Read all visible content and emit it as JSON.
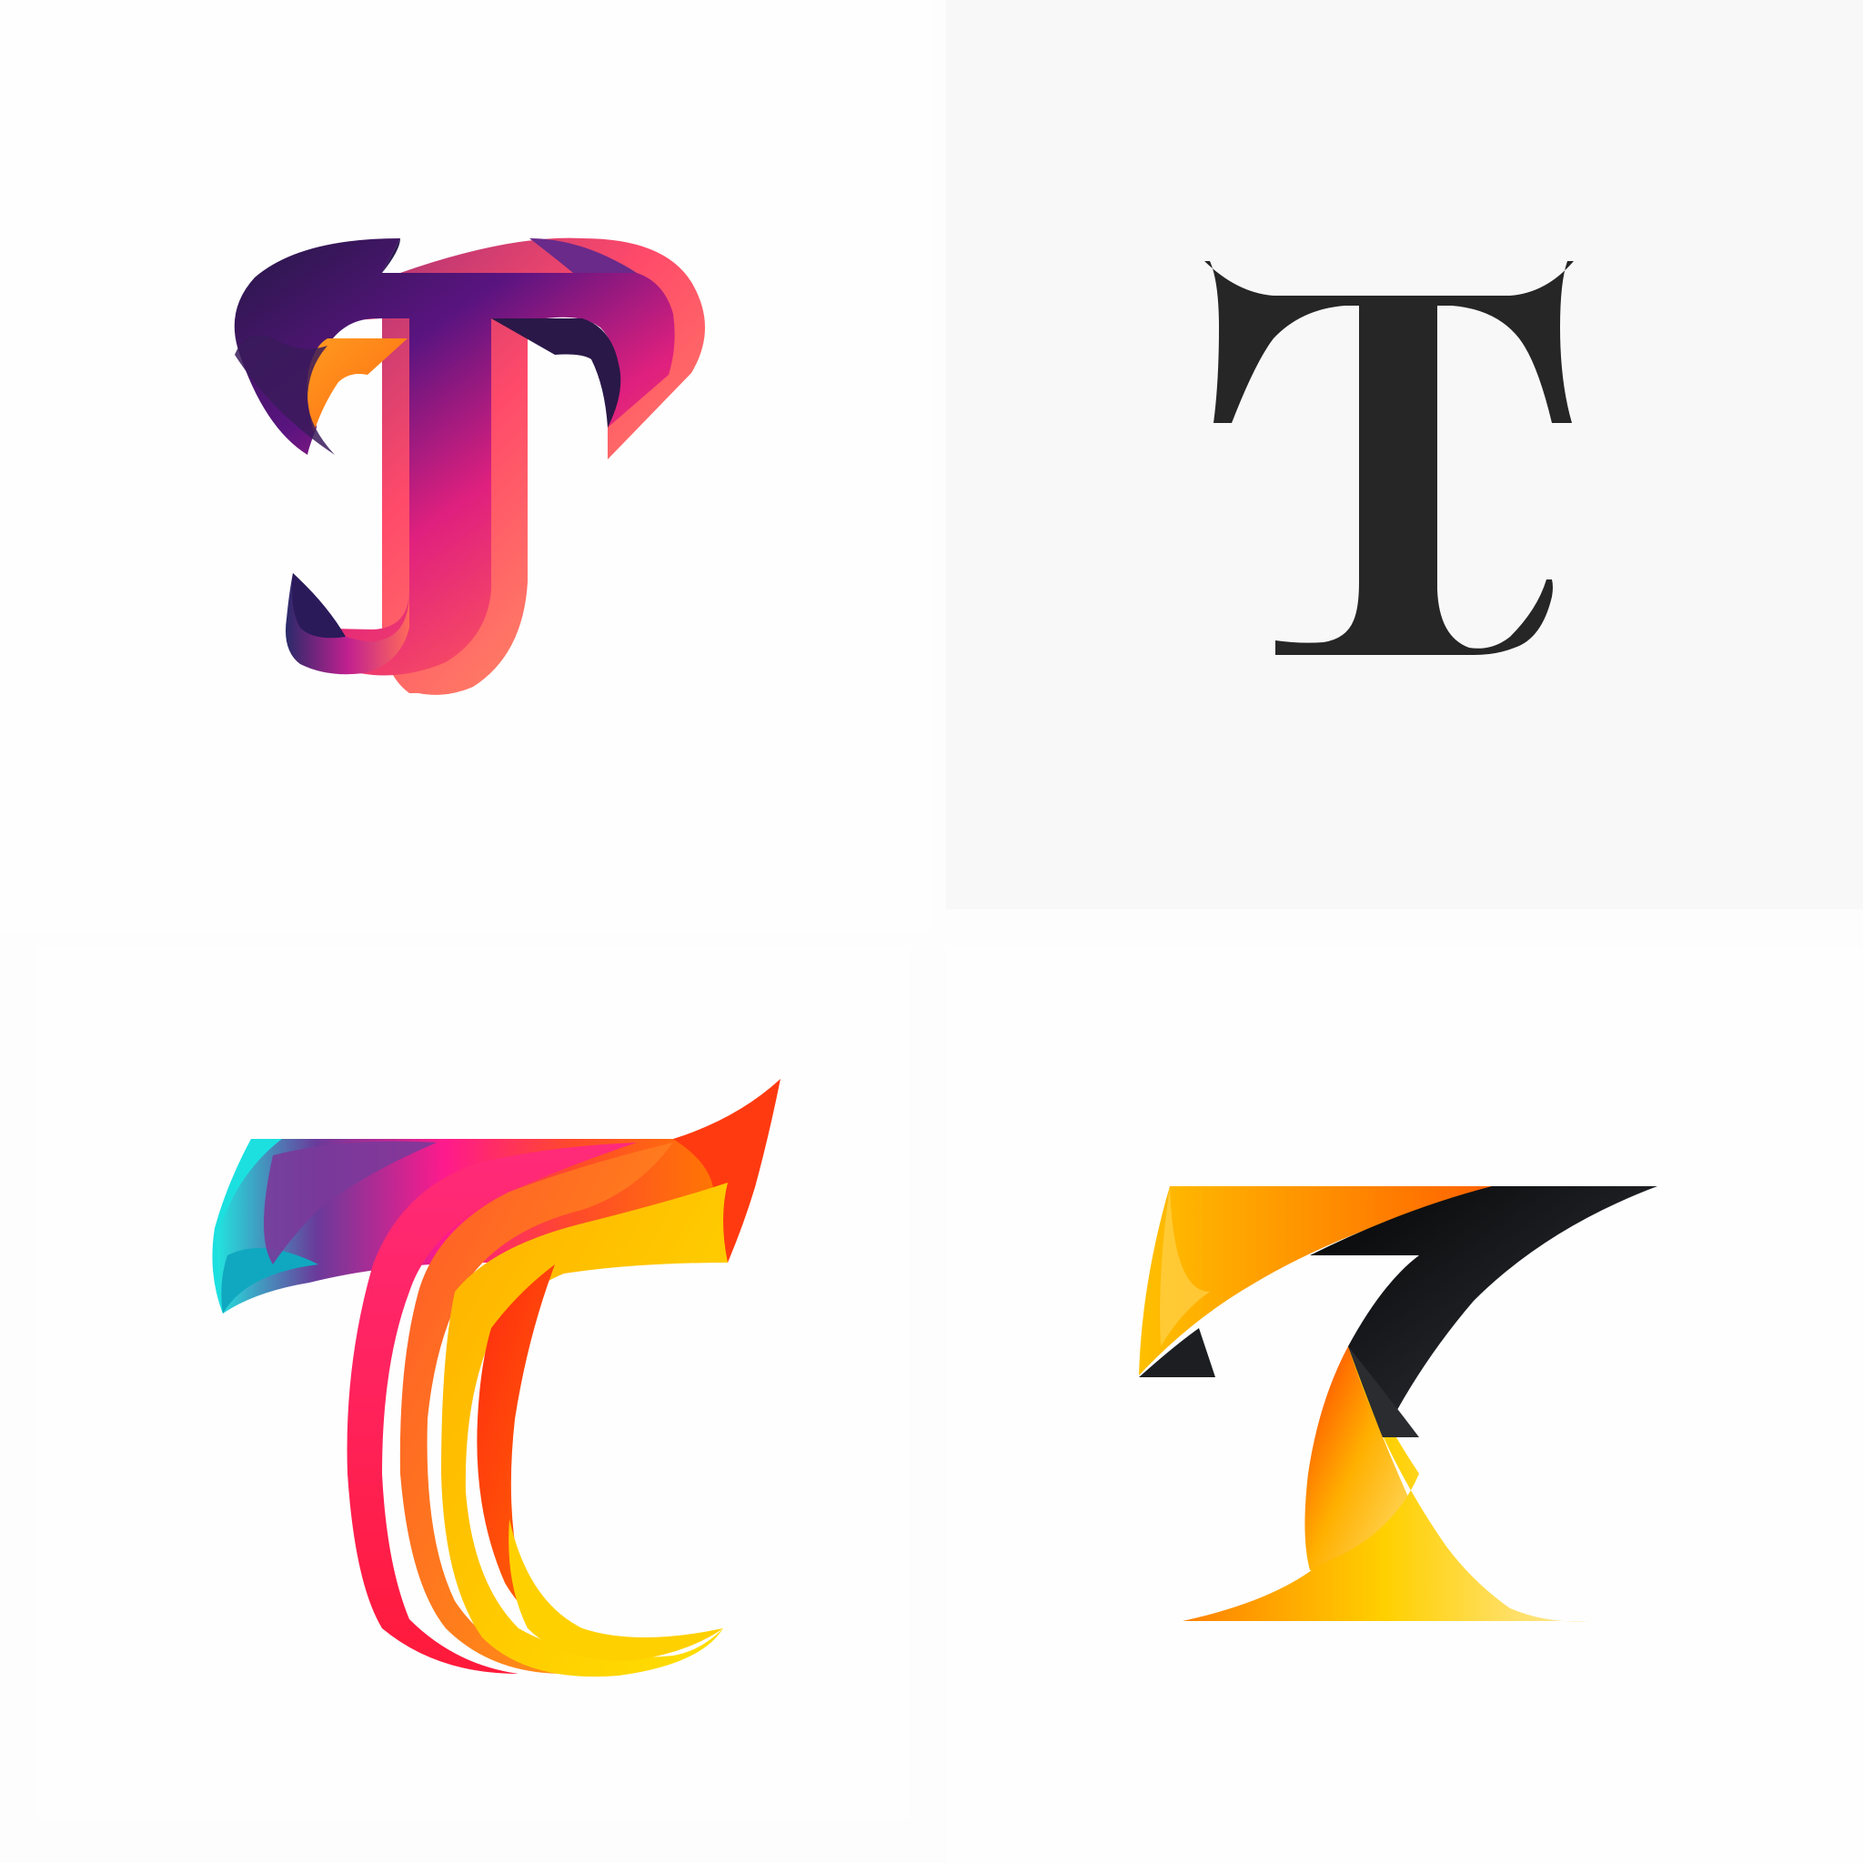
{
  "canvas": {
    "background": "#fdfdfd",
    "grid": "2x2"
  },
  "logos": [
    {
      "letter": "T",
      "style": "3D extruded serif T with purple-to-orange gradient",
      "colors": [
        "#2a1a4a",
        "#6a1a8a",
        "#e91e8c",
        "#ff5a5f",
        "#ff9a55"
      ]
    },
    {
      "letter": "T",
      "style": "classic black serif T on light grey tile",
      "colors": [
        "#262626",
        "#f8f8f8"
      ]
    },
    {
      "letter": "T",
      "style": "layered ribbon T with cyan-purple-pink-orange-yellow gradient",
      "colors": [
        "#1ee6e6",
        "#6a3a9a",
        "#ff1a8c",
        "#ff4a1a",
        "#ff8a00",
        "#ffd400"
      ]
    },
    {
      "letter": "T",
      "style": "angular folded T in orange, yellow and black",
      "colors": [
        "#ffb400",
        "#ff6a00",
        "#ffd400",
        "#111111",
        "#2e3138"
      ]
    }
  ]
}
